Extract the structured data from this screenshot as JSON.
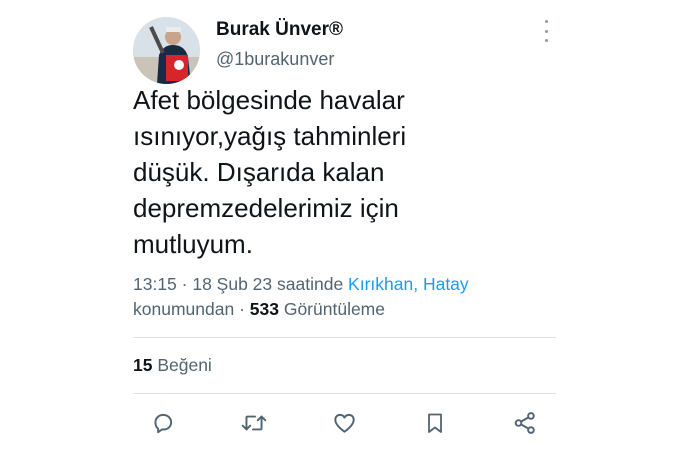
{
  "author": {
    "name": "Burak Ünver®",
    "handle": "@1burakunver"
  },
  "tweet": {
    "lines": [
      "Afet bölgesinde havalar",
      "ısınıyor,yağış tahminleri",
      "düşük. Dışarıda kalan",
      "depremzedelerimiz için",
      "mutluyum."
    ]
  },
  "meta": {
    "time": "13:15",
    "sep1": " · ",
    "date": "18 Şub 23",
    "place_prefix": " saatinde ",
    "location": "Kırıkhan, Hatay",
    "place_suffix": "konumundan",
    "sep2": " · ",
    "views_count": "533",
    "views_label": " Görüntüleme"
  },
  "stats": {
    "likes_count": "15",
    "likes_label": " Beğeni"
  },
  "icons": {
    "more": "more-vertical-icon",
    "reply": "reply-icon",
    "retweet": "retweet-icon",
    "like": "heart-icon",
    "bookmark": "bookmark-icon",
    "share": "share-icon"
  },
  "colors": {
    "text": "#0f1419",
    "secondary": "#536471",
    "link": "#1d9bf0",
    "divider": "#dfe3e7"
  }
}
